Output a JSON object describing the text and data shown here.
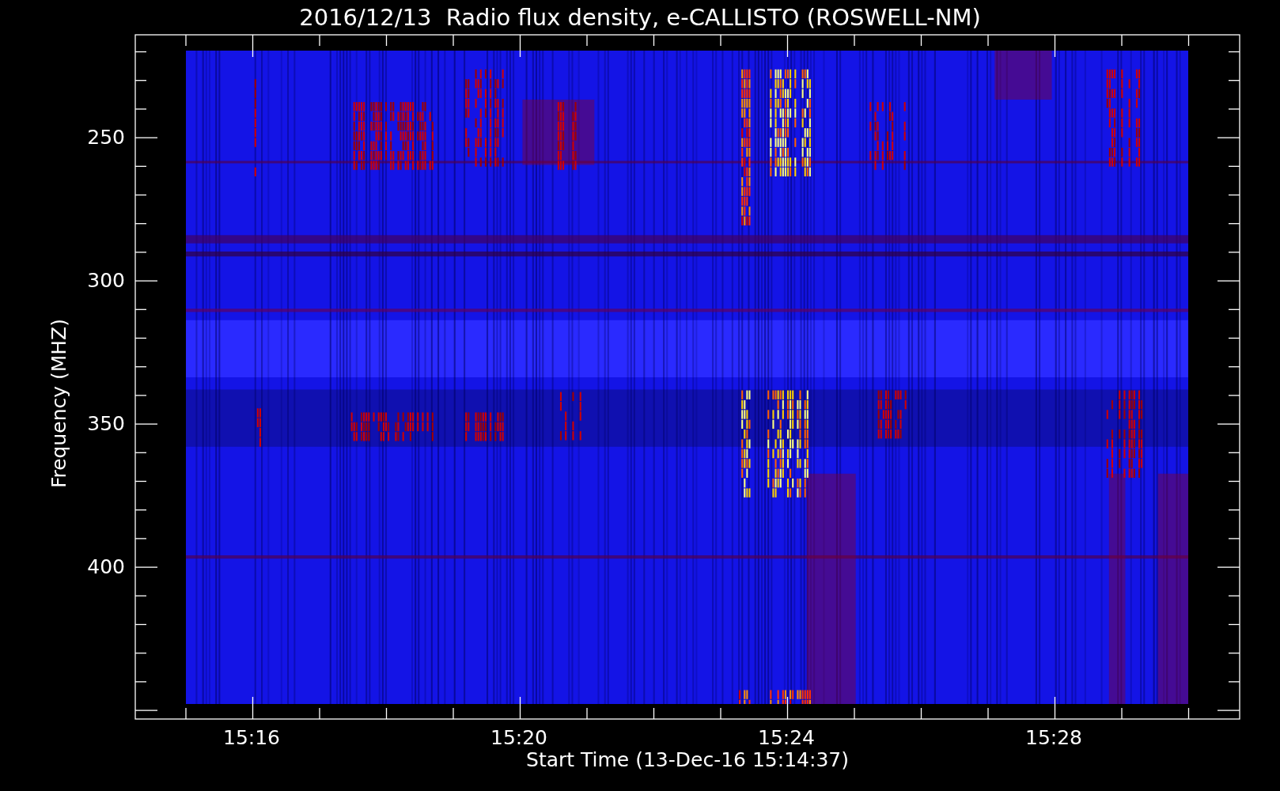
{
  "title": "2016/12/13  Radio flux density, e-CALLISTO (ROSWELL-NM)",
  "y_axis": {
    "label": "Frequency (MHZ)",
    "ticks": [
      "250",
      "300",
      "350",
      "400"
    ]
  },
  "x_axis": {
    "label": "Start Time (13-Dec-16 15:14:37)",
    "ticks": [
      "15:16",
      "15:20",
      "15:24",
      "15:28"
    ]
  }
}
